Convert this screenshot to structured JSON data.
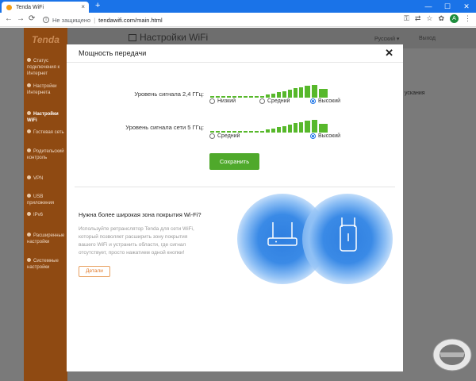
{
  "browser": {
    "tab_title": "Tenda WiFi",
    "tab_close": "×",
    "new_tab": "+",
    "security_label": "Не защищено",
    "url": "tendawifi.com/main.html",
    "avatar_letter": "A",
    "window_controls": [
      "—",
      "☐",
      "✕"
    ]
  },
  "header": {
    "logo": "Tenda",
    "page_title": "Настройки WiFi",
    "language": "Русский ▾",
    "logout": "Выход"
  },
  "sidebar": {
    "items": [
      {
        "label": "Статус подключения к Интернет"
      },
      {
        "label": "Настройки Интернета"
      },
      {
        "label": "Настройки WiFi"
      },
      {
        "label": "Гостевая сеть"
      },
      {
        "label": "Родительский контроль"
      },
      {
        "label": "VPN"
      },
      {
        "label": "USB приложения"
      },
      {
        "label": "IPv6"
      },
      {
        "label": "Расширенные настройки"
      },
      {
        "label": "Системные настройки"
      }
    ],
    "active_index": 2
  },
  "behind_text": "ускания",
  "modal": {
    "title": "Мощность передачи",
    "close": "✕",
    "band_24": {
      "label": "Уровень сигнала 2,4 ГГц:",
      "options": [
        "Низкий",
        "Средний",
        "Высокий"
      ],
      "selected": "Высокий"
    },
    "band_5": {
      "label": "Уровень сигнала сети 5 ГГц:",
      "options": [
        "Средний",
        "Высокий"
      ],
      "selected": "Высокий"
    },
    "save_label": "Сохранить",
    "promo": {
      "title": "Нужна более широкая зона покрытия Wi-Fi?",
      "text": "Используйте ретранслятор Tenda для сети WiFi, который позволяет расширить зону покрытия вашего WiFi и устранить области, где сигнал отсутствует, просто нажатием одной кнопки!",
      "details_label": "Детали"
    }
  },
  "colors": {
    "accent_green": "#57b82b",
    "save_green": "#4fa92b",
    "sidebar_brown": "#8f4a12",
    "glow_blue": "#2f7fe0",
    "detail_orange": "#e07a2a"
  }
}
